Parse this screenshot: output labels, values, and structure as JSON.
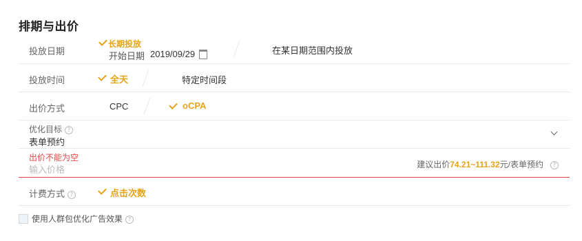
{
  "section": {
    "title": "排期与出价"
  },
  "schedule_date": {
    "label": "投放日期",
    "option_long": "长期投放",
    "start_label": "开始日期",
    "start_value": "2019/09/29",
    "option_range": "在某日期范围内投放"
  },
  "schedule_time": {
    "label": "投放时间",
    "option_all": "全天",
    "option_specific": "特定时间段"
  },
  "bid_method": {
    "label": "出价方式",
    "option_cpc": "CPC",
    "option_ocpa": "oCPA"
  },
  "goal": {
    "label": "优化目标",
    "value": "表单预约"
  },
  "price": {
    "error": "出价不能为空",
    "placeholder": "输入价格",
    "suggest_prefix": "建议出价",
    "suggest_range": "74.21~111.32",
    "suggest_suffix": "元/表单预约"
  },
  "billing": {
    "label": "计费方式",
    "option": "点击次数"
  },
  "audience": {
    "checkbox_label": "使用人群包优化广告效果",
    "checked": false
  },
  "colors": {
    "accent": "#e6a317",
    "error": "#e54545",
    "text": "#333333",
    "muted": "#666666"
  }
}
